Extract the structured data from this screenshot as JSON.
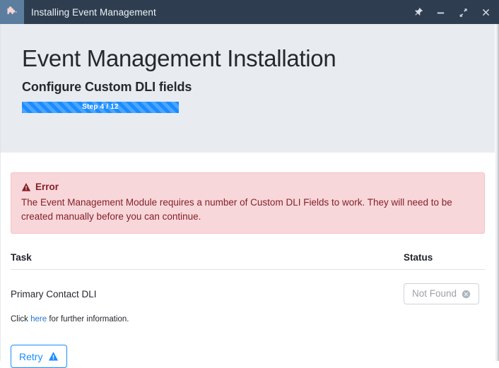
{
  "titlebar": {
    "app_icon": "puzzle-piece-icon",
    "title": "Installing Event Management",
    "controls": [
      {
        "name": "pin-icon",
        "label": "Pin"
      },
      {
        "name": "minimize-icon",
        "label": "Minimize"
      },
      {
        "name": "maximize-icon",
        "label": "Maximize"
      },
      {
        "name": "close-icon",
        "label": "Close"
      }
    ],
    "bg_color": "#2e3e50",
    "icon_bg_color": "#5b7e9e"
  },
  "header": {
    "title": "Event Management Installation",
    "subtitle": "Configure Custom DLI fields",
    "progress": {
      "label": "Step 4 / 12",
      "current_step": 4,
      "total_steps": 12,
      "percent": 100,
      "color": "#1a8cff"
    },
    "bg_color": "#e8ecf0"
  },
  "alert": {
    "type": "error",
    "icon": "warning-triangle-icon",
    "title": "Error",
    "message": "The Event Management Module requires a number of Custom DLI Fields to work. They will need to be created manually before you can continue.",
    "bg_color": "#f8d7da",
    "text_color": "#842029"
  },
  "table": {
    "columns": [
      "Task",
      "Status"
    ],
    "rows": [
      {
        "task": "Primary Contact DLI",
        "status_label": "Not Found",
        "status_icon": "circle-x-icon"
      }
    ]
  },
  "note": {
    "prefix": "Click ",
    "link_text": "here",
    "suffix": " for further information.",
    "link_color": "#2176d2"
  },
  "footer": {
    "retry_label": "Retry",
    "retry_icon": "warning-triangle-icon",
    "accent_color": "#1a8cff"
  }
}
